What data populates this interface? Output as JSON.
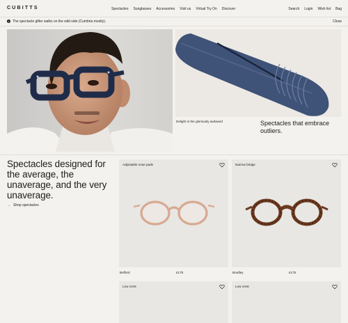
{
  "brand": {
    "logo_text": "CUBITTS"
  },
  "nav": {
    "center_links": [
      "Spectacles",
      "Sunglasses",
      "Accessories",
      "Visit us",
      "Virtual Try On",
      "Discover"
    ],
    "right_links": [
      "Search",
      "Login",
      "Wish list",
      "Bag"
    ]
  },
  "banner": {
    "text": "The spectacle gifter walks on the wild side (Cumbria mostly).",
    "close_label": "Close",
    "icon": "info-icon"
  },
  "hero": {
    "case_caption": "Delight in the gloriously awkward",
    "case_heading": "Spectacles that embrace outliers."
  },
  "intro": {
    "headline": "Spectacles designed for the average, the unaverage, and the very unaverage.",
    "shop_link": "Shop spectacles",
    "arrow": "→"
  },
  "products": [
    {
      "tag": "Adjustable nose pads",
      "name": "Belford",
      "price": "£175",
      "frame_color": "#d8a890"
    },
    {
      "tag": "Narrow bridge",
      "name": "Bradley",
      "price": "£175",
      "frame_color": "#6b3a20"
    },
    {
      "tag": "Low crest",
      "name": "",
      "price": ""
    },
    {
      "tag": "Low crest",
      "name": "",
      "price": ""
    }
  ],
  "colors": {
    "background": "#f3f2ee",
    "text": "#1c1c1c",
    "card": "#e8e7e3",
    "case_blue": "#3f5277",
    "frame_navy": "#1f2c49"
  }
}
